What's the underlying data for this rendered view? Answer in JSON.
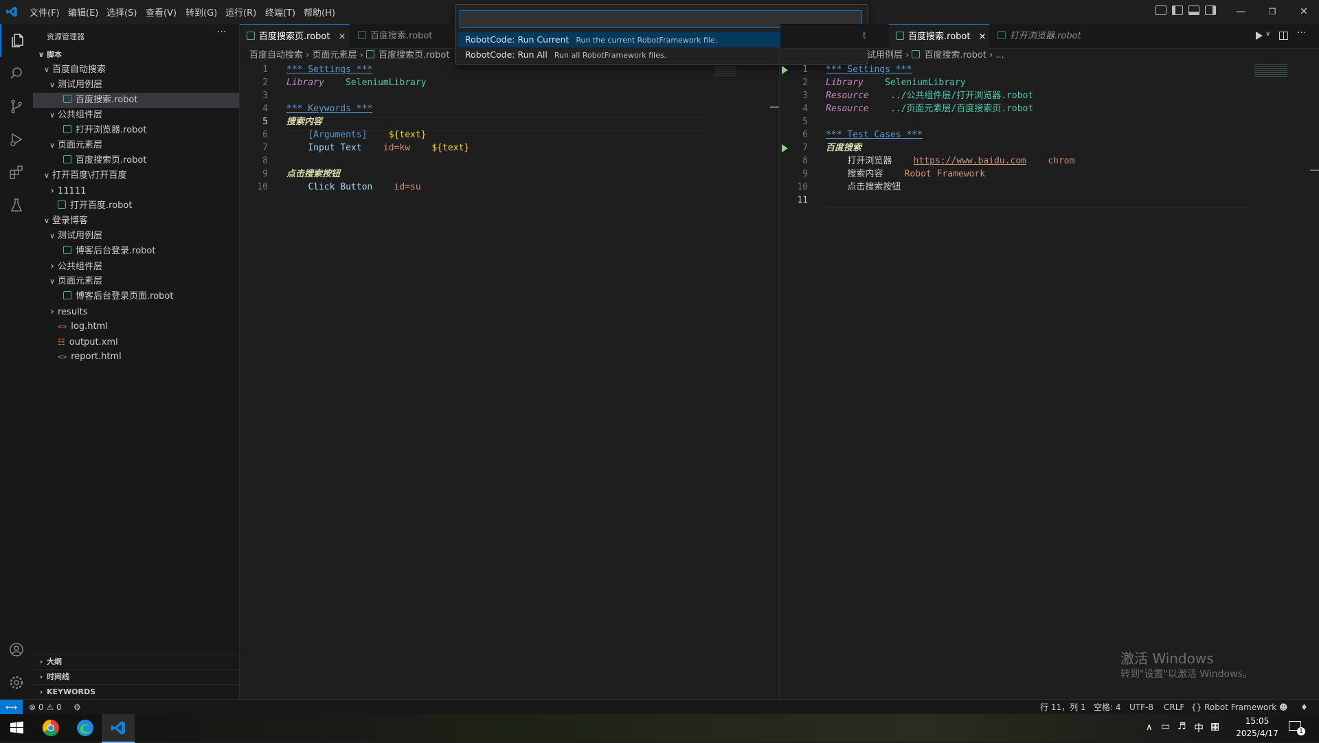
{
  "menu": [
    "文件(F)",
    "编辑(E)",
    "选择(S)",
    "查看(V)",
    "转到(G)",
    "运行(R)",
    "终端(T)",
    "帮助(H)"
  ],
  "command_palette": {
    "input_value": "",
    "items": [
      {
        "label": "RobotCode: Run Current",
        "desc": "Run the current RobotFramework file."
      },
      {
        "label": "RobotCode: Run All",
        "desc": "Run all RobotFramework files."
      }
    ]
  },
  "sidebar": {
    "title": "资源管理器",
    "more": "···",
    "root": "脚本",
    "tree": [
      {
        "label": "百度自动搜索",
        "type": "folder-open",
        "indent": 1
      },
      {
        "label": "测试用例层",
        "type": "folder-open",
        "indent": 2
      },
      {
        "label": "百度搜索.robot",
        "type": "robot",
        "indent": 3,
        "selected": true
      },
      {
        "label": "公共组件层",
        "type": "folder-open",
        "indent": 2
      },
      {
        "label": "打开浏览器.robot",
        "type": "robot",
        "indent": 3
      },
      {
        "label": "页面元素层",
        "type": "folder-open",
        "indent": 2
      },
      {
        "label": "百度搜索页.robot",
        "type": "robot",
        "indent": 3
      },
      {
        "label": "打开百度\\打开百度",
        "type": "folder-open",
        "indent": 1
      },
      {
        "label": "11111",
        "type": "folder-closed",
        "indent": 2
      },
      {
        "label": "打开百度.robot",
        "type": "robot",
        "indent": 2
      },
      {
        "label": "登录博客",
        "type": "folder-open",
        "indent": 1
      },
      {
        "label": "测试用例层",
        "type": "folder-open",
        "indent": 2
      },
      {
        "label": "博客后台登录.robot",
        "type": "robot",
        "indent": 3
      },
      {
        "label": "公共组件层",
        "type": "folder-closed",
        "indent": 2
      },
      {
        "label": "页面元素层",
        "type": "folder-open",
        "indent": 2
      },
      {
        "label": "博客后台登录页面.robot",
        "type": "robot",
        "indent": 3
      },
      {
        "label": "results",
        "type": "folder-closed",
        "indent": 2
      },
      {
        "label": "log.html",
        "type": "html",
        "indent": 2
      },
      {
        "label": "output.xml",
        "type": "xml",
        "indent": 2
      },
      {
        "label": "report.html",
        "type": "html",
        "indent": 2
      }
    ],
    "sections": [
      "大纲",
      "时间线",
      "KEYWORDS"
    ]
  },
  "left_editor": {
    "tabs": [
      {
        "label": "百度搜索页.robot",
        "active": true,
        "close": "×"
      },
      {
        "label": "百度搜索.robot",
        "active": false
      }
    ],
    "breadcrumb": [
      "百度自动搜索",
      "页面元素层",
      "百度搜索页.robot"
    ],
    "line_numbers": [
      "1",
      "2",
      "3",
      "4",
      "5",
      "6",
      "7",
      "8",
      "9",
      "10"
    ],
    "current_line": "5",
    "lines": {
      "l1": "*** Settings ***",
      "l2_kw": "Library",
      "l2_val": "SeleniumLibrary",
      "l4": "*** Keywords ***",
      "l5": "搜索内容",
      "l6_set": "[Arguments]",
      "l6_var": "${text}",
      "l7_call": "Input Text",
      "l7_arg": "id=kw",
      "l7_var": "${text}",
      "l9": "点击搜索按钮",
      "l10_call": "Click Button",
      "l10_arg": "id=su"
    }
  },
  "right_editor": {
    "tabs": [
      {
        "label": "t",
        "active": false
      },
      {
        "label": "百度搜索.robot",
        "active": true,
        "close": "×"
      },
      {
        "label": "打开浏览器.robot",
        "active": false
      }
    ],
    "breadcrumb": [
      "试用例层",
      "百度搜索.robot",
      "..."
    ],
    "line_numbers": [
      "1",
      "2",
      "3",
      "4",
      "5",
      "6",
      "7",
      "8",
      "9",
      "10",
      "11"
    ],
    "current_line": "11",
    "lines": {
      "l1": "*** Settings ***",
      "l2_kw": "Library",
      "l2_val": "SeleniumLibrary",
      "l3_kw": "Resource",
      "l3_val": "../公共组件层/打开浏览器.robot",
      "l4_kw": "Resource",
      "l4_val": "../页面元素层/百度搜索页.robot",
      "l6": "*** Test Cases ***",
      "l7": "百度搜索",
      "l8_call": "打开浏览器",
      "l8_url": "https://www.baidu.com",
      "l8_arg": "chrom",
      "l9_call": "搜索内容",
      "l9_arg": "Robot Framework",
      "l10_call": "点击搜索按钮"
    }
  },
  "watermark": {
    "line1": "激活 Windows",
    "line2": "转到\"设置\"以激活 Windows。"
  },
  "statusbar": {
    "errors": "0",
    "warnings": "0",
    "position": "行 11，列 1",
    "spaces": "空格: 4",
    "encoding": "UTF-8",
    "eol": "CRLF",
    "language": "Robot Framework"
  },
  "taskbar": {
    "time": "15:05",
    "date": "2025/4/17",
    "ime": "中",
    "notif_count": "1"
  },
  "colors": {
    "accent": "#0078d4",
    "robot_file": "#3fb8a7",
    "run_green": "#89d185"
  }
}
